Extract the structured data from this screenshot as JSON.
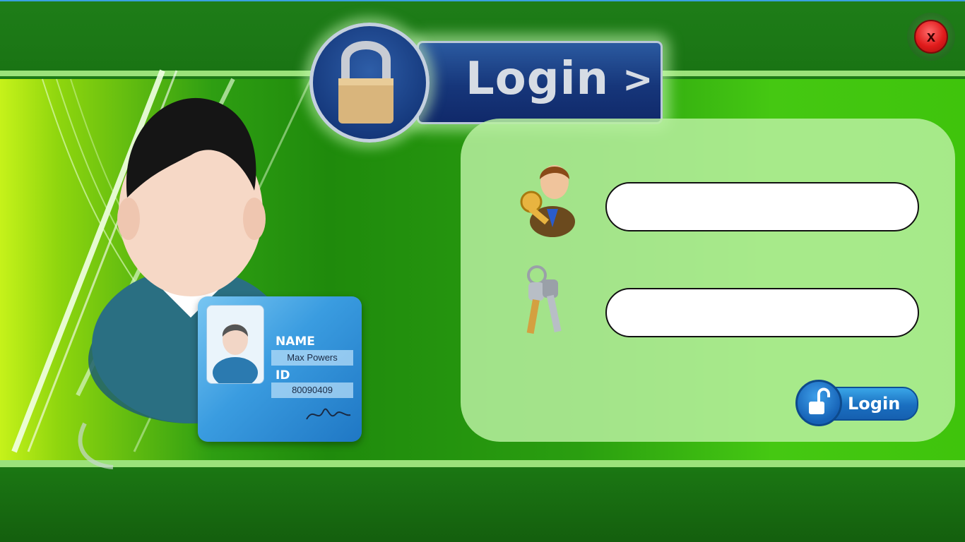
{
  "window": {
    "close_label": "x",
    "close_icon": "close-icon"
  },
  "banner": {
    "title": "Login",
    "arrow": ">",
    "icon": "padlock-icon"
  },
  "avatar_card": {
    "name_label": "NAME",
    "name_value": "Max Powers",
    "id_label": "ID",
    "id_value": "80090409"
  },
  "form": {
    "username": {
      "icon": "user-key-icon",
      "value": "",
      "placeholder": ""
    },
    "password": {
      "icon": "keys-icon",
      "value": "",
      "placeholder": ""
    },
    "submit_label": "Login",
    "submit_icon": "unlock-icon"
  },
  "colors": {
    "accent_green": "#1f8a0c",
    "banner_blue": "#16367a",
    "close_red": "#e01b1b",
    "button_blue": "#1a6fc0"
  }
}
